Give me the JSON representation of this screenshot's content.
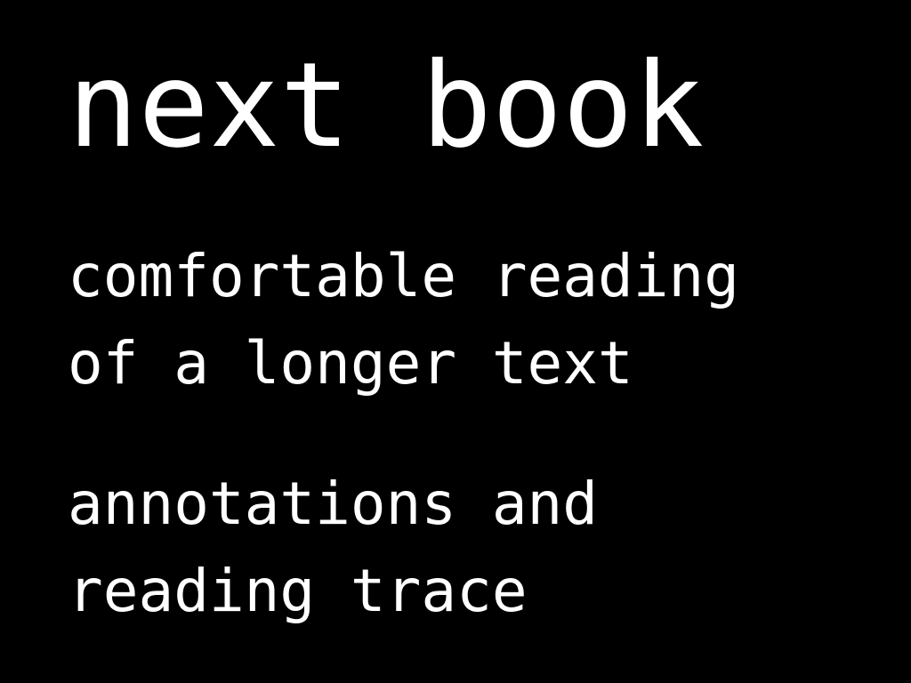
{
  "slide": {
    "background_color": "#000000",
    "text_color": "#ffffff",
    "heading": "next book",
    "point_1": {
      "line_1": "comfortable reading",
      "line_2": "of a longer text"
    },
    "point_2": {
      "line_1": "annotations and",
      "line_2": "reading trace"
    }
  }
}
